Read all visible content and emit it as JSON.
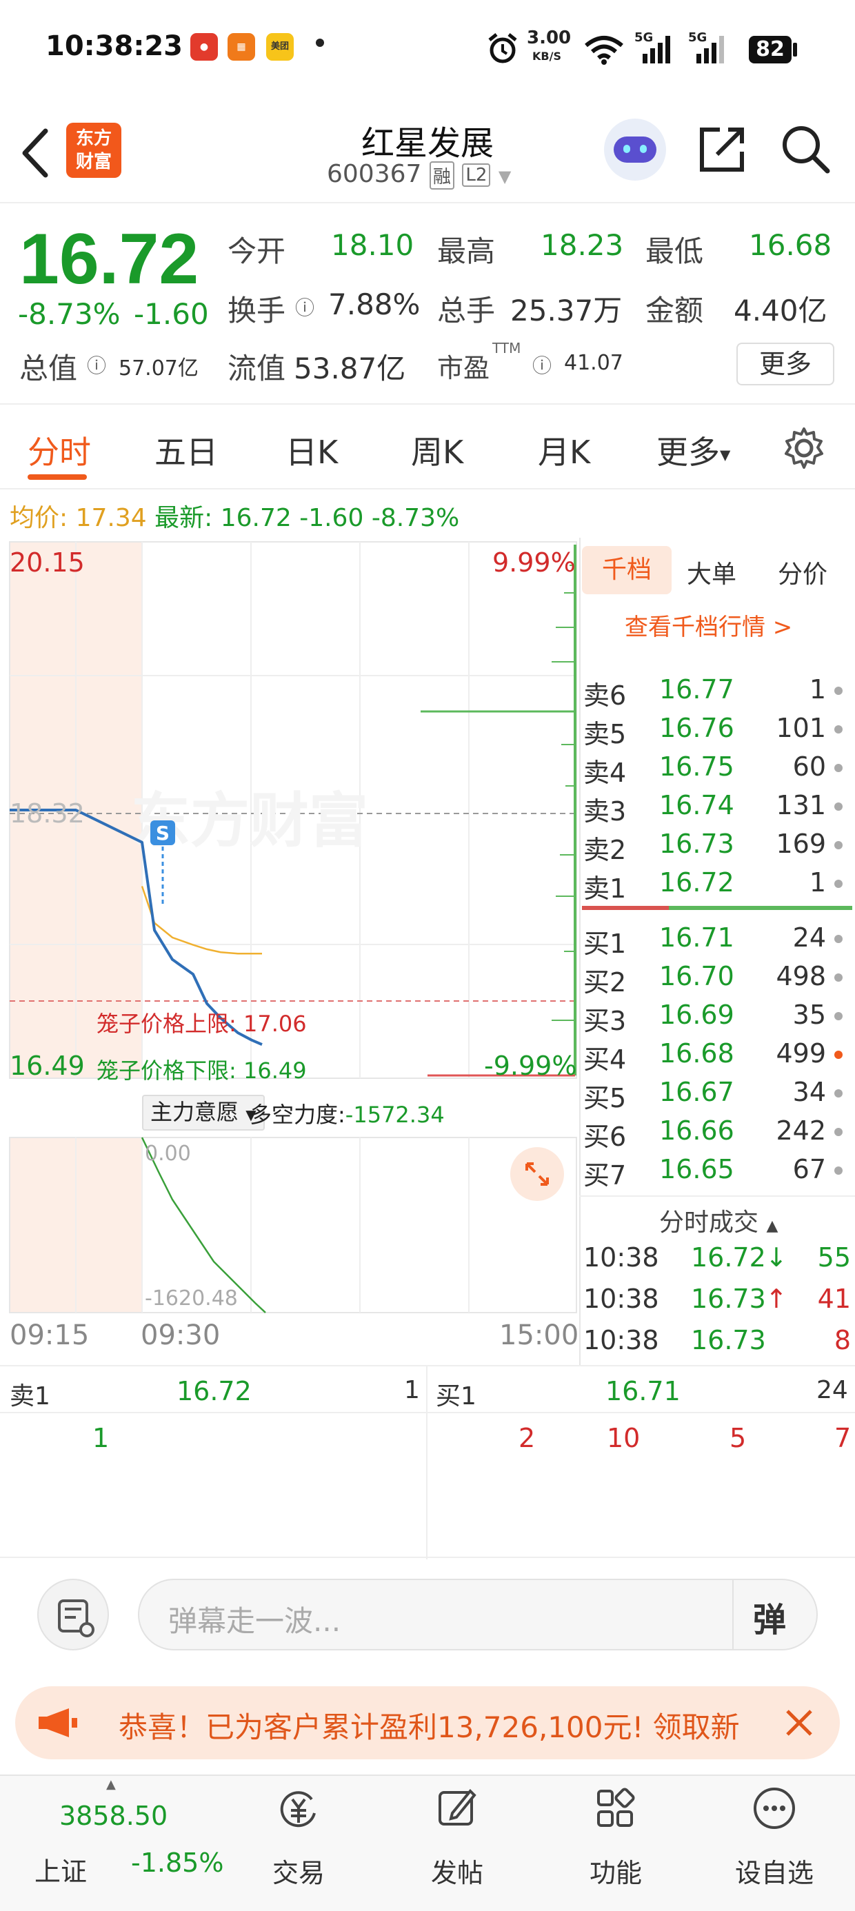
{
  "status_bar": {
    "time": "10:38:23",
    "net_speed": "3.00",
    "net_unit": "KB/S",
    "battery": "82",
    "sig1": "5G",
    "sig2": "5G",
    "app3": "美团"
  },
  "header": {
    "logo_line1": "东方",
    "logo_line2": "财富",
    "title": "红星发展",
    "code": "600367",
    "badge1": "融",
    "badge2": "L2"
  },
  "quote": {
    "price": "16.72",
    "change_pct": "-8.73%",
    "change": "-1.60",
    "open_label": "今开",
    "open": "18.10",
    "high_label": "最高",
    "high": "18.23",
    "low_label": "最低",
    "low": "16.68",
    "turnover_label": "换手",
    "turnover": "7.88%",
    "volume_label": "总手",
    "volume": "25.37万",
    "amount_label": "金额",
    "amount": "4.40亿",
    "mktcap_label": "总值",
    "mktcap": "57.07亿",
    "float_label": "流值",
    "float": "53.87亿",
    "pe_label": "市盈",
    "pe_sup": "TTM",
    "pe": "41.07",
    "more": "更多"
  },
  "tabs": [
    "分时",
    "五日",
    "日K",
    "周K",
    "月K",
    "更多"
  ],
  "infoline": {
    "avg_label": "均价:",
    "avg": "17.34",
    "latest_label": "最新:",
    "latest": "16.72",
    "chg": "-1.60",
    "pct": "-8.73%"
  },
  "chart": {
    "top_price": "20.15",
    "top_pct": "9.99%",
    "mid_price": "18.32",
    "bottom_price": "16.49",
    "bottom_pct": "-9.99%",
    "cage_upper_label": "笼子价格上限:",
    "cage_upper": "17.06",
    "cage_lower_label": "笼子价格下限:",
    "cage_lower": "16.49",
    "s_marker": "S",
    "watermark": "东方财富",
    "indicator_select": "主力意愿",
    "indicator_label": "多空力度:",
    "indicator_value": "-1572.34",
    "ind_top": "0.00",
    "ind_bottom": "-1620.48",
    "time_start": "09:15",
    "time_open": "09:30",
    "time_end": "15:00"
  },
  "chart_data": {
    "type": "line",
    "title": "",
    "x": [
      "09:15",
      "09:20",
      "09:25",
      "09:30",
      "09:31",
      "09:32",
      "09:33",
      "09:34",
      "09:35",
      "09:36",
      "09:37",
      "09:38"
    ],
    "series": [
      {
        "values": [
          18.32,
          18.32,
          18.32,
          18.1,
          17.5,
          17.3,
          17.2,
          17.0,
          16.9,
          16.8,
          16.75,
          16.72
        ]
      },
      {
        "values": [
          null,
          null,
          null,
          17.8,
          17.55,
          17.45,
          17.4,
          17.37,
          17.35,
          17.34,
          17.34,
          17.34
        ]
      }
    ],
    "ylim": [
      16.49,
      20.15
    ]
  },
  "depth": {
    "tabs": [
      "千档",
      "大单",
      "分价"
    ],
    "link": "查看千档行情 >",
    "sell": [
      {
        "label": "卖6",
        "price": "16.77",
        "vol": "1"
      },
      {
        "label": "卖5",
        "price": "16.76",
        "vol": "101"
      },
      {
        "label": "卖4",
        "price": "16.75",
        "vol": "60"
      },
      {
        "label": "卖3",
        "price": "16.74",
        "vol": "131"
      },
      {
        "label": "卖2",
        "price": "16.73",
        "vol": "169"
      },
      {
        "label": "卖1",
        "price": "16.72",
        "vol": "1"
      }
    ],
    "buy": [
      {
        "label": "买1",
        "price": "16.71",
        "vol": "24"
      },
      {
        "label": "买2",
        "price": "16.70",
        "vol": "498"
      },
      {
        "label": "买3",
        "price": "16.69",
        "vol": "35"
      },
      {
        "label": "买4",
        "price": "16.68",
        "vol": "499"
      },
      {
        "label": "买5",
        "price": "16.67",
        "vol": "34"
      },
      {
        "label": "买6",
        "price": "16.66",
        "vol": "242"
      },
      {
        "label": "买7",
        "price": "16.65",
        "vol": "67"
      }
    ],
    "ticks_title": "分时成交",
    "ticks": [
      {
        "time": "10:38",
        "price": "16.72",
        "arrow": "↓",
        "vol": "55"
      },
      {
        "time": "10:38",
        "price": "16.73",
        "arrow": "↑",
        "vol": "41"
      },
      {
        "time": "10:38",
        "price": "16.73",
        "arrow": "",
        "vol": "8"
      }
    ]
  },
  "band": {
    "sell_label": "卖1",
    "sell_price": "16.72",
    "sell_vol": "1",
    "sell_q1": "1",
    "buy_label": "买1",
    "buy_price": "16.71",
    "buy_vol": "24",
    "buy_q": [
      "2",
      "10",
      "5",
      "7"
    ]
  },
  "danmu": {
    "placeholder": "弹幕走一波...",
    "btn": "弹"
  },
  "promo": {
    "text": "恭喜！已为客户累计盈利13,726,100元! 领取新"
  },
  "nav": {
    "index_value": "3858.50",
    "index_name": "上证",
    "index_pct": "-1.85%",
    "items": [
      "交易",
      "发帖",
      "功能",
      "设自选"
    ]
  }
}
